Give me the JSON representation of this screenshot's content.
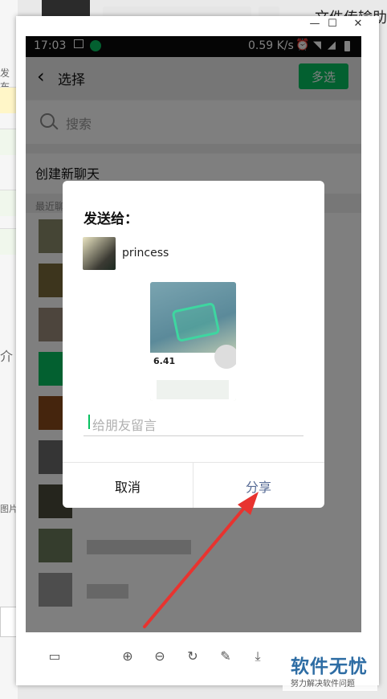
{
  "background": {
    "right_window_title": "文件传输助",
    "left_labels": [
      "发布",
      "介",
      "图片"
    ]
  },
  "phone": {
    "status": {
      "time": "17:03",
      "speed": "0.59 K/s"
    },
    "appbar": {
      "title": "选择",
      "multi_select": "多选"
    },
    "search_placeholder": "搜索",
    "new_chat": "创建新聊天",
    "recent_header": "最近聊"
  },
  "dialog": {
    "title": "发送给：",
    "recipient": "princess",
    "screenshot_distance": "6.41",
    "message_placeholder": "给朋友留言",
    "cancel": "取消",
    "share": "分享"
  },
  "toolbar": {
    "icons": [
      "sidebar-icon",
      "zoom-in-icon",
      "zoom-out-icon",
      "rotate-icon",
      "edit-icon",
      "download-icon"
    ]
  },
  "watermark": {
    "main": "软件无忧",
    "sub": "努力解决软件问题"
  },
  "colors": {
    "wechat_green": "#07c160",
    "link_blue": "#576b95",
    "arrow_red": "#e8332f"
  }
}
